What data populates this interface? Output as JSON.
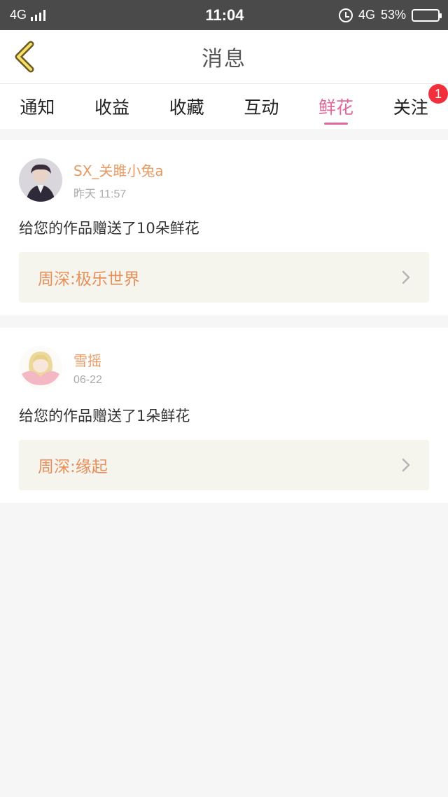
{
  "status": {
    "network_left": "4G",
    "time": "11:04",
    "network_right": "4G",
    "battery": "53%",
    "battery_level": 0.53
  },
  "header": {
    "title": "消息",
    "back_icon": "chevron-left-icon"
  },
  "tabs": [
    {
      "label": "通知",
      "active": false
    },
    {
      "label": "收益",
      "active": false
    },
    {
      "label": "收藏",
      "active": false
    },
    {
      "label": "互动",
      "active": false
    },
    {
      "label": "鲜花",
      "active": true
    },
    {
      "label": "关注",
      "active": false,
      "badge": "1"
    }
  ],
  "messages": [
    {
      "username": "SX_关雎小兔a",
      "date": "昨天 11:57",
      "text": "给您的作品赠送了10朵鲜花",
      "work": "周深:极乐世界"
    },
    {
      "username": "雪摇",
      "date": "06-22",
      "text": "给您的作品赠送了1朵鲜花",
      "work": "周深:缘起"
    }
  ],
  "colors": {
    "accent": "#e2679a",
    "username": "#e89a63",
    "work_title": "#e68f5b",
    "badge": "#f0313d"
  }
}
